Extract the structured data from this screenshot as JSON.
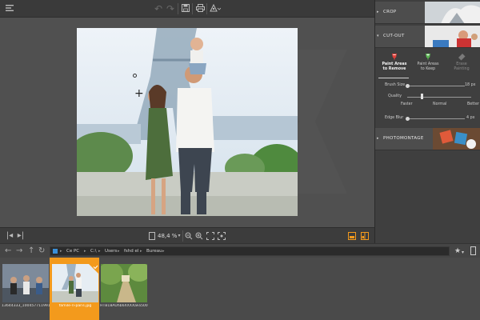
{
  "panel": {
    "crop_label": "CROP",
    "cutout_label": "CUT-OUT",
    "photomontage_label": "PHOTOMONTAGE",
    "tools": [
      {
        "line1": "Paint Areas",
        "line2": "to Remove",
        "color": "#e0413b"
      },
      {
        "line1": "Paint Areas",
        "line2": "to Keep",
        "color": "#5ab552"
      },
      {
        "line1": "Erase",
        "line2": "Painting",
        "color": "#7a7a7a"
      }
    ],
    "brush_size_label": "Brush Size",
    "brush_size_value": "18 px",
    "quality_label": "Quality",
    "quality_faster": "Faster",
    "quality_normal": "Normal",
    "quality_better": "Better",
    "edge_blur_label": "Edge Blur",
    "edge_blur_value": "4 px"
  },
  "navbar": {
    "zoom_value": "48,4 %"
  },
  "explorer": {
    "crumbs": [
      "Ce PC",
      "C:\\",
      "Users",
      "fshd el",
      "Bureau"
    ]
  },
  "thumbnails": [
    {
      "caption": "13644333_10045771199120..."
    },
    {
      "caption": "famile-ri-paris.jpg"
    },
    {
      "caption": "HTB18AUhb6XXXXaFa500Xp..."
    }
  ],
  "colors": {
    "accent": "#f39a1c",
    "remove": "#e0413b",
    "keep": "#5ab552"
  }
}
